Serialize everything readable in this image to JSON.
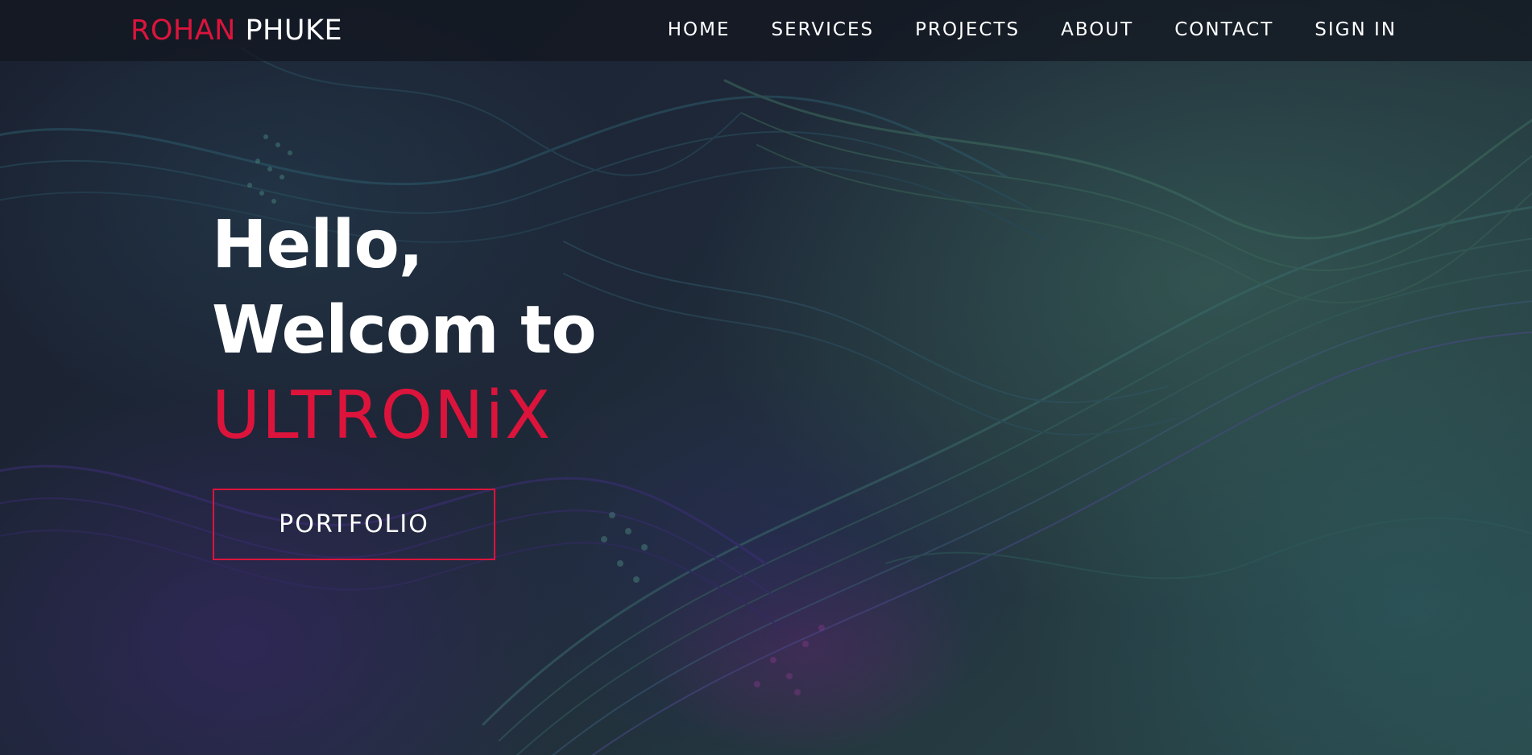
{
  "header": {
    "logo_first": "ROHAN",
    "logo_last": "PHUKE",
    "nav_items": [
      {
        "label": "HOME"
      },
      {
        "label": "SERVICES"
      },
      {
        "label": "PROJECTS"
      },
      {
        "label": "ABOUT"
      },
      {
        "label": "CONTACT"
      },
      {
        "label": "SIGN IN"
      }
    ]
  },
  "hero": {
    "line1": "Hello,",
    "line2": "Welcom to",
    "brand": "ULTRONiX",
    "cta_label": "PORTFOLIO"
  },
  "colors": {
    "accent": "#dc143c",
    "text": "#ffffff",
    "navbar_bg": "#12161e"
  }
}
